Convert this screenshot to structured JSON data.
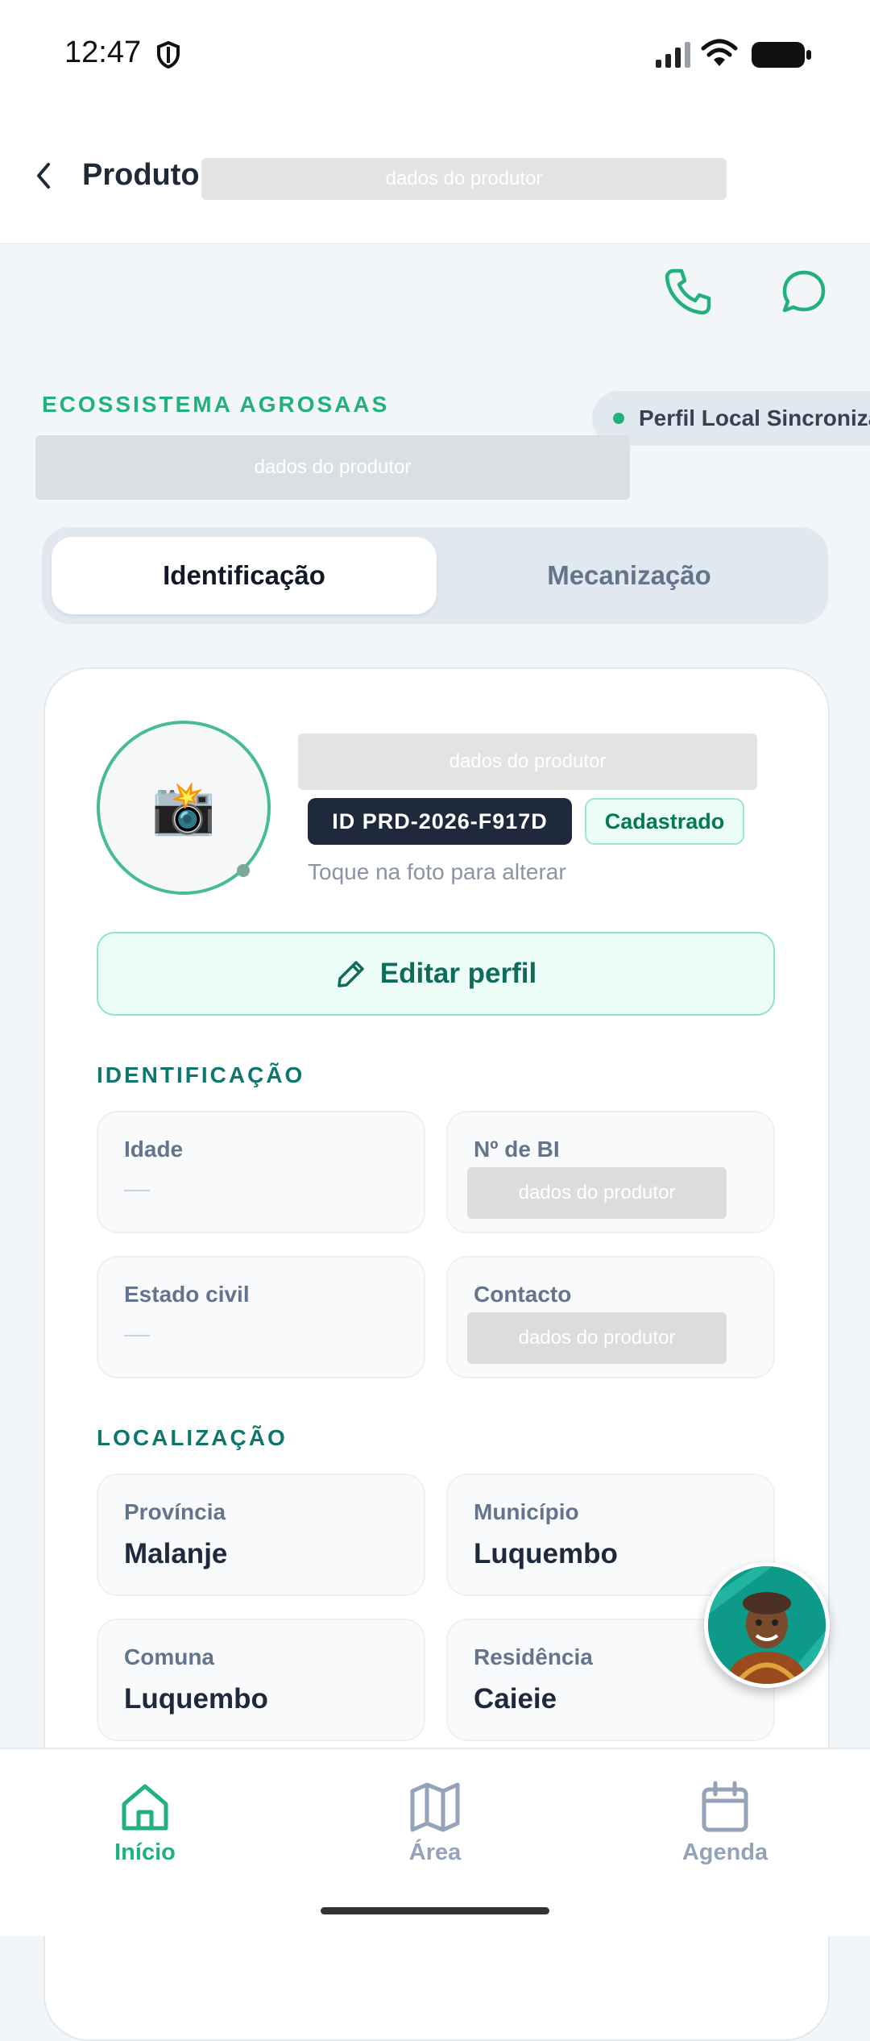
{
  "status_bar": {
    "time": "12:47"
  },
  "header": {
    "title": "Produtor",
    "redacted_text": "dados do produtor"
  },
  "actions": {
    "phone": "phone-icon",
    "chat": "chat-icon"
  },
  "brand": {
    "label": "ECOSSISTEMA AGROSAAS",
    "redacted_text": "dados do produtor",
    "sync_label": "Perfil Local Sincroniza"
  },
  "tabs": [
    {
      "label": "Identificação",
      "active": true
    },
    {
      "label": "Mecanização",
      "active": false
    }
  ],
  "profile": {
    "name_redacted": "dados do produtor",
    "photo_icon": "📸",
    "id_badge": "ID PRD-2026-F917D",
    "status_badge": "Cadastrado",
    "photo_hint": "Toque na foto para alterar",
    "edit_label": "Editar perfil"
  },
  "identification": {
    "section_title": "IDENTIFICAÇÃO",
    "fields": [
      {
        "label": "Idade",
        "value": "—"
      },
      {
        "label": "Nº de BI",
        "value": "dados do produtor"
      },
      {
        "label": "Estado civil",
        "value": "—"
      },
      {
        "label": "Contacto",
        "value": "dados do produtor"
      }
    ]
  },
  "location": {
    "section_title": "LOCALIZAÇÃO",
    "fields": [
      {
        "label": "Província",
        "value": "Malanje"
      },
      {
        "label": "Município",
        "value": "Luquembo"
      },
      {
        "label": "Comuna",
        "value": "Luquembo"
      },
      {
        "label": "Residência",
        "value": "Caieie"
      }
    ]
  },
  "bottom_nav": [
    {
      "label": "Início",
      "active": true
    },
    {
      "label": "Área",
      "active": false
    },
    {
      "label": "Agenda",
      "active": false
    }
  ],
  "colors": {
    "accent": "#22b07d",
    "dark": "#1e293b",
    "muted": "#64748b"
  }
}
